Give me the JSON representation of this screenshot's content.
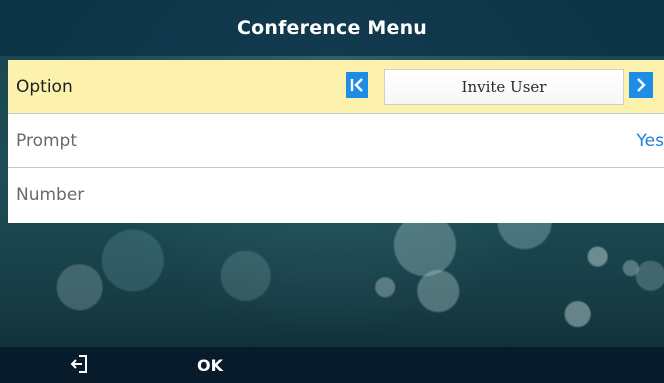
{
  "title": "Conference Menu",
  "rows": [
    {
      "label": "Option",
      "selected": true,
      "selector_value": "Invite User",
      "prev_icon": "first-arrow-icon",
      "next_icon": "next-arrow-icon"
    },
    {
      "label": "Prompt",
      "selected": false,
      "value": "Yes"
    },
    {
      "label": "Number",
      "selected": false,
      "value": ""
    }
  ],
  "softkeys": [
    {
      "icon": "exit-icon"
    },
    {
      "label": "OK"
    }
  ],
  "colors": {
    "accent": "#1e8de6",
    "value_text": "#1e7fd8",
    "selected_row": "#fcf1ad",
    "title_bar": "#082d44",
    "softkey_bar": "#071b2b"
  }
}
